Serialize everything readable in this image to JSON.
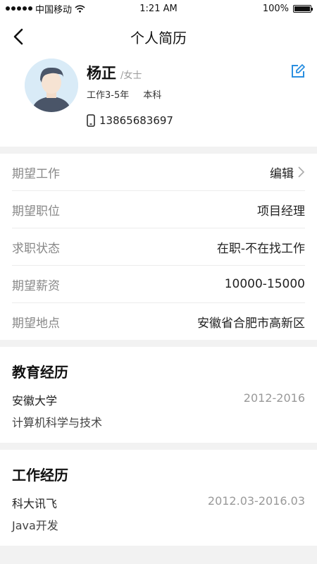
{
  "status_bar": {
    "carrier": "中国移动",
    "time": "1:21 AM",
    "battery": "100%"
  },
  "nav": {
    "title": "个人简历"
  },
  "profile": {
    "name": "杨正",
    "gender": "/女士",
    "experience": "工作3-5年",
    "education": "本科",
    "phone": "13865683697"
  },
  "expect": {
    "rows": [
      {
        "label": "期望工作",
        "value": "编辑"
      },
      {
        "label": "期望职位",
        "value": "项目经理"
      },
      {
        "label": "求职状态",
        "value": "在职-不在找工作"
      },
      {
        "label": "期望薪资",
        "value": "10000-15000"
      },
      {
        "label": "期望地点",
        "value": "安徽省合肥市高新区"
      }
    ]
  },
  "education": {
    "title": "教育经历",
    "school": "安徽大学",
    "period": "2012-2016",
    "major": "计算机科学与技术"
  },
  "work": {
    "title": "工作经历",
    "company": "科大讯飞",
    "period": "2012.03-2016.03",
    "position": "Java开发"
  },
  "colors": {
    "accent": "#2a8fe0",
    "label": "#888888",
    "background": "#f2f2f2"
  }
}
